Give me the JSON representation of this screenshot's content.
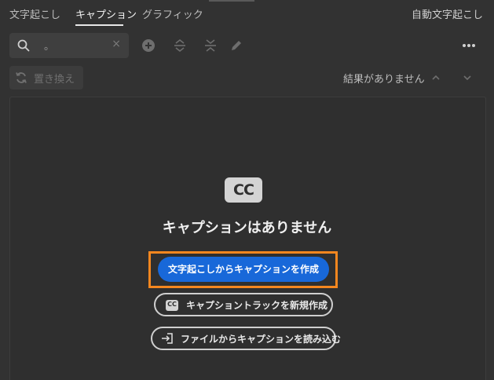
{
  "tabs": [
    {
      "label": "文字起こし",
      "active": false
    },
    {
      "label": "キャプション",
      "active": true
    },
    {
      "label": "グラフィック",
      "active": false
    }
  ],
  "right_tab": {
    "label": "自動文字起こし"
  },
  "toolbar": {
    "search_value": "。",
    "clear_glyph": "×",
    "icons": [
      "add-icon",
      "expand-icon",
      "collapse-icon",
      "pencil-icon",
      "more-icon"
    ]
  },
  "replace": {
    "label": "置き換え"
  },
  "results": {
    "label": "結果がありません"
  },
  "empty_state": {
    "badge": "CC",
    "title": "キャプションはありません",
    "primary_button": "文字起こしからキャプションを作成",
    "new_track_button": "キャプショントラックを新規作成",
    "new_track_badge": "CC",
    "import_button": "ファイルからキャプションを読み込む"
  },
  "colors": {
    "background": "#323232",
    "accent": "#1868d9",
    "highlight": "#f5871f"
  }
}
